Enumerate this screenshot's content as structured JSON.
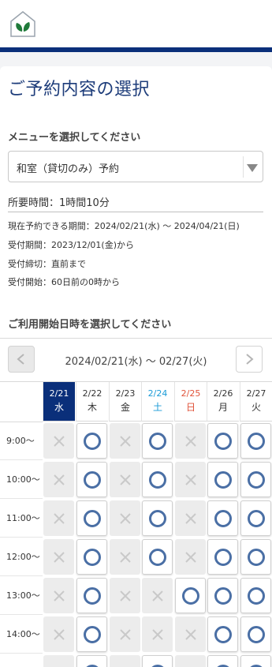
{
  "page_title": "ご予約内容の選択",
  "menu": {
    "label": "メニューを選択してください",
    "selected": "和室（貸切のみ）予約"
  },
  "duration": "所要時間：1時間10分",
  "info": {
    "period": "現在予約できる期間：2024/02/21(水) ～ 2024/04/21(日)",
    "accept_period": "受付期間：2023/12/01(金)から",
    "deadline": "受付締切：直前まで",
    "start": "受付開始：60日前の0時から"
  },
  "schedule": {
    "label": "ご利用開始日時を選択してください",
    "week_range": "2024/02/21(水) ～ 02/27(火)",
    "days": [
      {
        "date": "2/21",
        "weekday": "水",
        "type": "today"
      },
      {
        "date": "2/22",
        "weekday": "木",
        "type": "weekday"
      },
      {
        "date": "2/23",
        "weekday": "金",
        "type": "weekday"
      },
      {
        "date": "2/24",
        "weekday": "土",
        "type": "sat"
      },
      {
        "date": "2/25",
        "weekday": "日",
        "type": "sun"
      },
      {
        "date": "2/26",
        "weekday": "月",
        "type": "weekday"
      },
      {
        "date": "2/27",
        "weekday": "火",
        "type": "weekday"
      }
    ],
    "times": [
      "9:00～",
      "10:00～",
      "11:00～",
      "12:00～",
      "13:00～",
      "14:00～",
      ""
    ],
    "availability": [
      [
        "x",
        "o",
        "x",
        "o",
        "x",
        "o",
        "o"
      ],
      [
        "x",
        "o",
        "x",
        "o",
        "x",
        "o",
        "o"
      ],
      [
        "x",
        "o",
        "x",
        "o",
        "x",
        "o",
        "o"
      ],
      [
        "x",
        "o",
        "x",
        "o",
        "x",
        "o",
        "o"
      ],
      [
        "x",
        "o",
        "x",
        "x",
        "o",
        "o",
        "o"
      ],
      [
        "x",
        "o",
        "x",
        "x",
        "x",
        "o",
        "o"
      ],
      [
        "x",
        "o",
        "x",
        "o",
        "x",
        "o",
        "o"
      ]
    ]
  },
  "colors": {
    "brand": "#0a2f7a",
    "title": "#1d3c7a",
    "available": "#4a6fa5",
    "unavailable": "#c9c9c9",
    "saturday": "#1a9bd7",
    "sunday": "#e0533a"
  }
}
